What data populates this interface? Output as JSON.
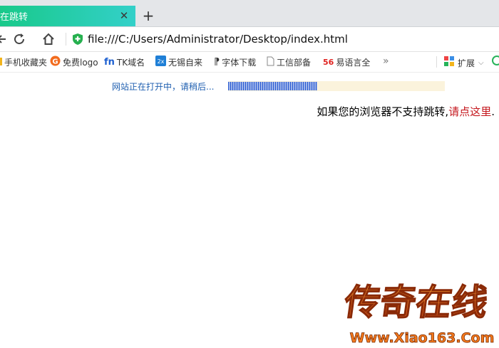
{
  "tab": {
    "title": "在跳转"
  },
  "address_bar": {
    "url": "file:///C:/Users/Administrator/Desktop/index.html"
  },
  "bookmarks": [
    {
      "label": "手机收藏夹",
      "icon": "folder-icon"
    },
    {
      "label": "免费logo",
      "icon": "g-logo-icon"
    },
    {
      "label": "TK域名",
      "icon": "fn-logo-icon"
    },
    {
      "label": "无锡自来",
      "icon": "app-logo-icon"
    },
    {
      "label": "字体下载",
      "icon": "font-icon"
    },
    {
      "label": "工信部备",
      "icon": "page-icon"
    },
    {
      "label": "易语言全",
      "icon": "56-logo-icon"
    }
  ],
  "extensions": {
    "label": "扩展"
  },
  "page": {
    "loading_text": "网站正在打开中，请稍后...",
    "progress": 0.41,
    "redirect_prefix": "如果您的浏览器不支持跳转,",
    "redirect_link": "请点这里",
    "redirect_suffix": "."
  },
  "watermark": {
    "title": "传奇在线",
    "site": "Www.Xiao163.Com"
  },
  "colors": {
    "tab_gradient_start": "#19c98a",
    "tab_gradient_end": "#33d0c9",
    "link_red": "#c4161c",
    "loading_blue": "#1f5fb0",
    "progress_blue": "#2a5bd0",
    "progress_track": "#fbf3dc"
  }
}
